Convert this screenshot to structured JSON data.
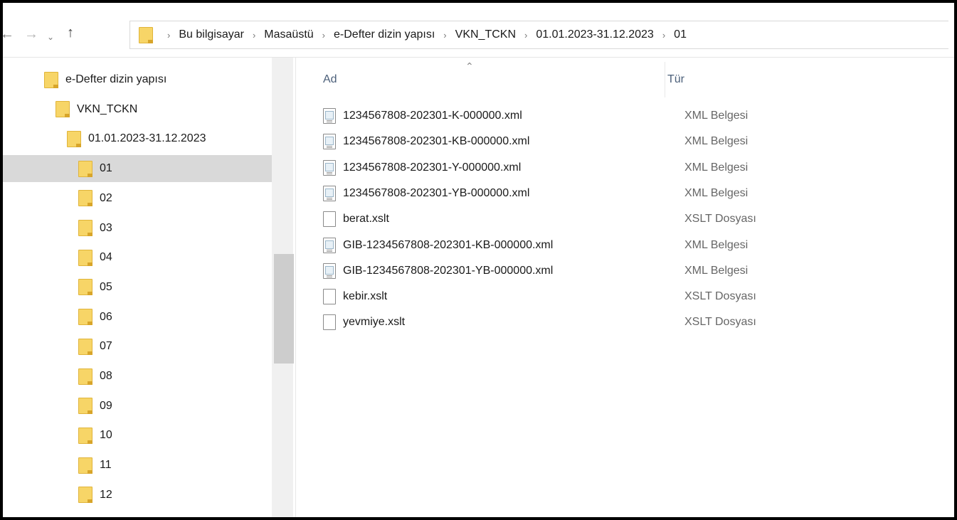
{
  "breadcrumbs": [
    "Bu bilgisayar",
    "Masaüstü",
    "e-Defter dizin yapısı",
    "VKN_TCKN",
    "01.01.2023-31.12.2023",
    "01"
  ],
  "nav": {
    "back": "←",
    "forward": "→",
    "recent": "⌄",
    "up": "↑",
    "separator": "›"
  },
  "tree": [
    {
      "label": "e-Defter dizin yapısı",
      "indent": 0
    },
    {
      "label": "VKN_TCKN",
      "indent": 1
    },
    {
      "label": "01.01.2023-31.12.2023",
      "indent": 2
    },
    {
      "label": "01",
      "indent": 3,
      "selected": true
    },
    {
      "label": "02",
      "indent": 3
    },
    {
      "label": "03",
      "indent": 3
    },
    {
      "label": "04",
      "indent": 3
    },
    {
      "label": "05",
      "indent": 3
    },
    {
      "label": "06",
      "indent": 3
    },
    {
      "label": "07",
      "indent": 3
    },
    {
      "label": "08",
      "indent": 3
    },
    {
      "label": "09",
      "indent": 3
    },
    {
      "label": "10",
      "indent": 3
    },
    {
      "label": "11",
      "indent": 3
    },
    {
      "label": "12",
      "indent": 3
    }
  ],
  "columns": {
    "name": "Ad",
    "type": "Tür"
  },
  "files": [
    {
      "name": "1234567808-202301-K-000000.xml",
      "type": "XML Belgesi",
      "icon": "xml-file-icon"
    },
    {
      "name": "1234567808-202301-KB-000000.xml",
      "type": "XML Belgesi",
      "icon": "xml-file-icon"
    },
    {
      "name": "1234567808-202301-Y-000000.xml",
      "type": "XML Belgesi",
      "icon": "xml-file-icon"
    },
    {
      "name": "1234567808-202301-YB-000000.xml",
      "type": "XML Belgesi",
      "icon": "xml-file-icon"
    },
    {
      "name": "berat.xslt",
      "type": "XSLT Dosyası",
      "icon": "blank-file-icon"
    },
    {
      "name": "GIB-1234567808-202301-KB-000000.xml",
      "type": "XML Belgesi",
      "icon": "xml-file-icon"
    },
    {
      "name": "GIB-1234567808-202301-YB-000000.xml",
      "type": "XML Belgesi",
      "icon": "xml-file-icon"
    },
    {
      "name": "kebir.xslt",
      "type": "XSLT Dosyası",
      "icon": "blank-file-icon"
    },
    {
      "name": "yevmiye.xslt",
      "type": "XSLT Dosyası",
      "icon": "blank-file-icon"
    }
  ]
}
